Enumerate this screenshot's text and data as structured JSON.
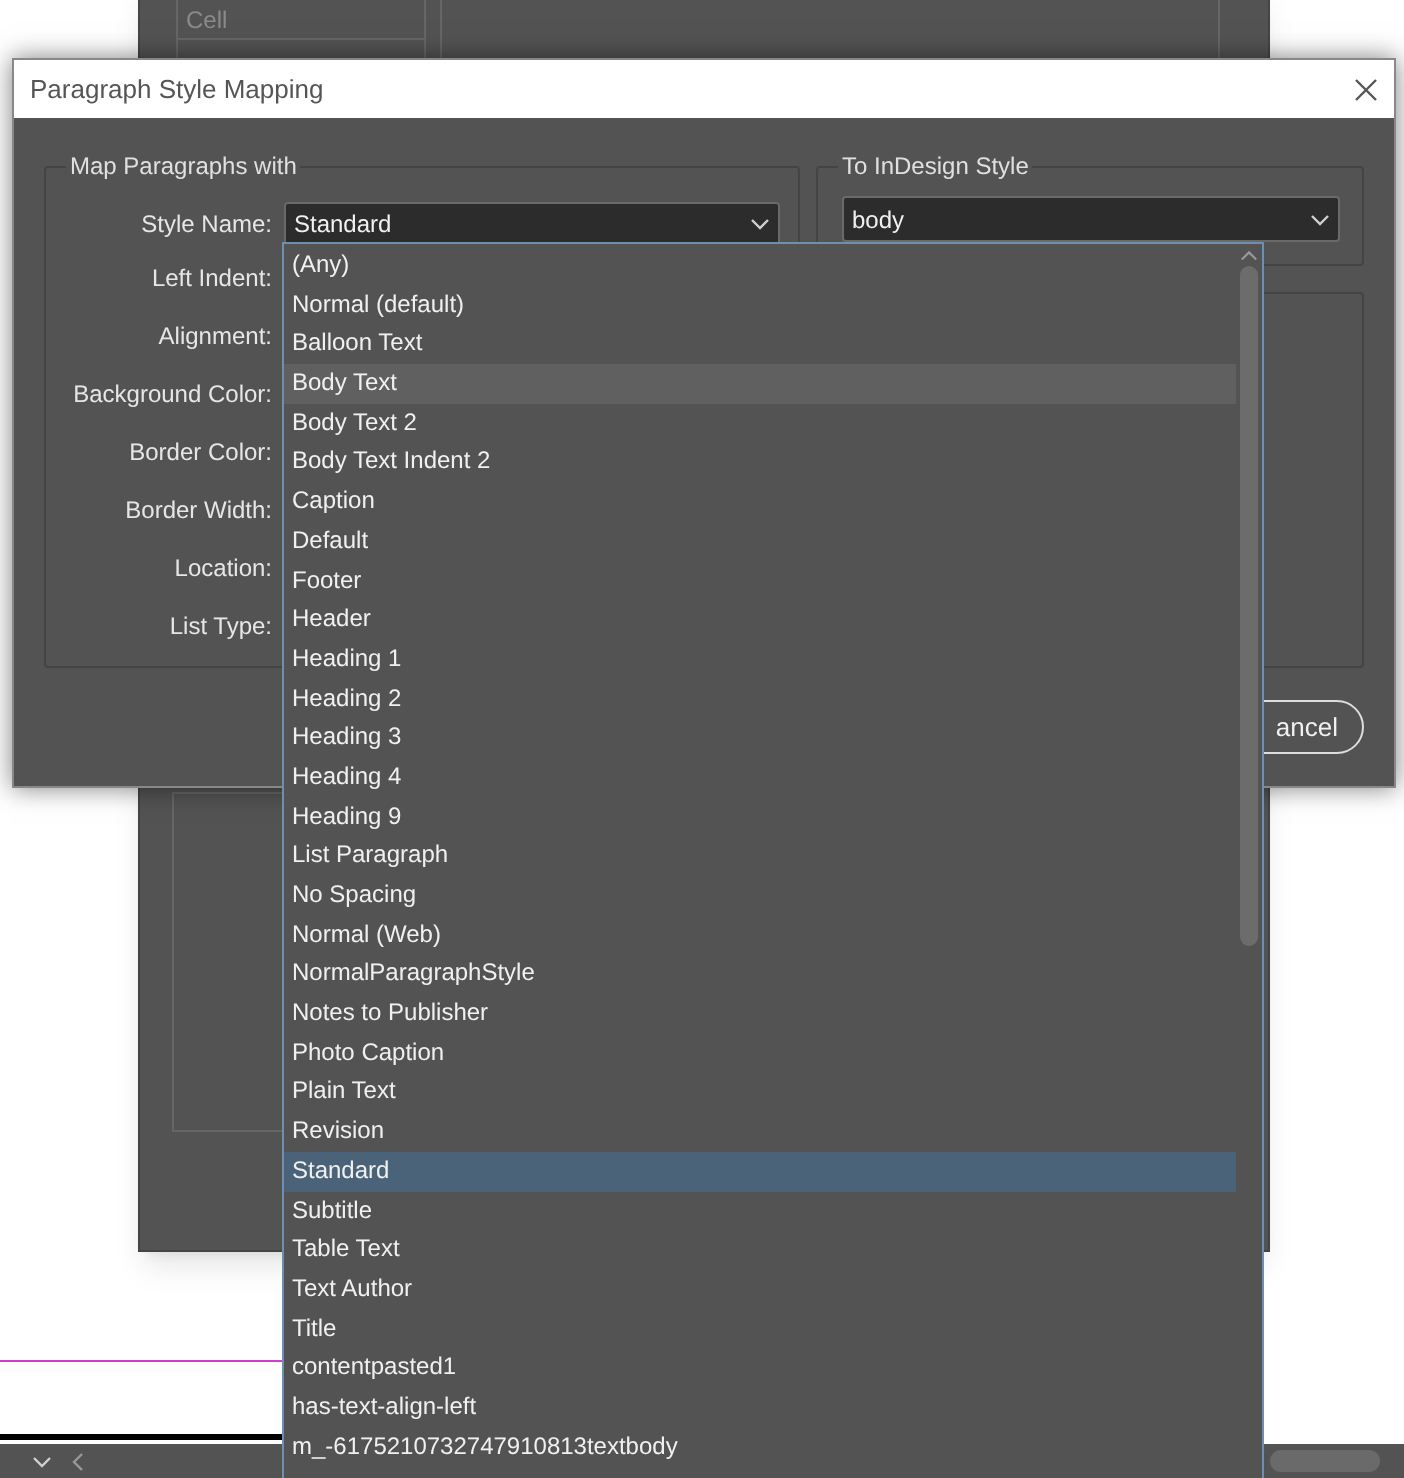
{
  "background_dialog": {
    "list_items": [
      "Cell"
    ]
  },
  "dialog": {
    "title": "Paragraph Style Mapping",
    "left_group": {
      "legend": "Map Paragraphs with",
      "style_name": {
        "label": "Style Name:",
        "value": "Standard"
      },
      "labels": [
        "Left Indent:",
        "Alignment:",
        "Background Color:",
        "Border Color:",
        "Border Width:",
        "Location:",
        "List Type:"
      ]
    },
    "right_group": {
      "legend": "To InDesign Style",
      "value": "body"
    },
    "cancel_button": "ancel"
  },
  "dropdown_list": [
    {
      "label": "(Any)",
      "selected": false,
      "hovered": false
    },
    {
      "label": "Normal (default)",
      "selected": false,
      "hovered": false
    },
    {
      "label": "Balloon Text",
      "selected": false,
      "hovered": false
    },
    {
      "label": "Body Text",
      "selected": false,
      "hovered": true
    },
    {
      "label": "Body Text 2",
      "selected": false,
      "hovered": false
    },
    {
      "label": "Body Text Indent 2",
      "selected": false,
      "hovered": false
    },
    {
      "label": "Caption",
      "selected": false,
      "hovered": false
    },
    {
      "label": "Default",
      "selected": false,
      "hovered": false
    },
    {
      "label": "Footer",
      "selected": false,
      "hovered": false
    },
    {
      "label": "Header",
      "selected": false,
      "hovered": false
    },
    {
      "label": "Heading 1",
      "selected": false,
      "hovered": false
    },
    {
      "label": "Heading 2",
      "selected": false,
      "hovered": false
    },
    {
      "label": "Heading 3",
      "selected": false,
      "hovered": false
    },
    {
      "label": "Heading 4",
      "selected": false,
      "hovered": false
    },
    {
      "label": "Heading 9",
      "selected": false,
      "hovered": false
    },
    {
      "label": "List Paragraph",
      "selected": false,
      "hovered": false
    },
    {
      "label": "No Spacing",
      "selected": false,
      "hovered": false
    },
    {
      "label": "Normal (Web)",
      "selected": false,
      "hovered": false
    },
    {
      "label": "NormalParagraphStyle",
      "selected": false,
      "hovered": false
    },
    {
      "label": "Notes to Publisher",
      "selected": false,
      "hovered": false
    },
    {
      "label": "Photo Caption",
      "selected": false,
      "hovered": false
    },
    {
      "label": "Plain Text",
      "selected": false,
      "hovered": false
    },
    {
      "label": "Revision",
      "selected": false,
      "hovered": false
    },
    {
      "label": "Standard",
      "selected": true,
      "hovered": false
    },
    {
      "label": "Subtitle",
      "selected": false,
      "hovered": false
    },
    {
      "label": "Table Text",
      "selected": false,
      "hovered": false
    },
    {
      "label": "Text Author",
      "selected": false,
      "hovered": false
    },
    {
      "label": "Title",
      "selected": false,
      "hovered": false
    },
    {
      "label": "contentpasted1",
      "selected": false,
      "hovered": false
    },
    {
      "label": "has-text-align-left",
      "selected": false,
      "hovered": false
    },
    {
      "label": "m_-6175210732747910813textbody",
      "selected": false,
      "hovered": false
    }
  ]
}
